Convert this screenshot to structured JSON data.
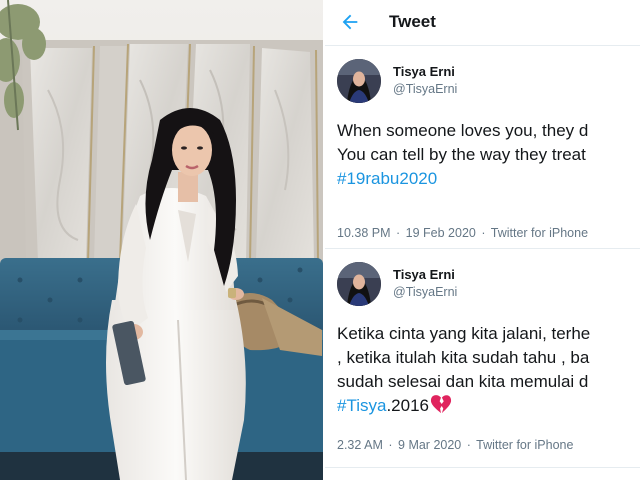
{
  "header": {
    "title": "Tweet",
    "back_icon": "back-arrow-icon"
  },
  "tweets": [
    {
      "display_name": "Tisya Erni",
      "handle": "@TisyaErni",
      "lines": [
        "When someone loves you, they d",
        "You can tell by the way they treat"
      ],
      "hashtag": "#19rabu2020",
      "time": "10.38 PM",
      "date": "19 Feb 2020",
      "source": "Twitter for iPhone"
    },
    {
      "display_name": "Tisya Erni",
      "handle": "@TisyaErni",
      "lines": [
        "Ketika cinta yang kita jalani, terhe",
        ", ketika itulah kita sudah tahu , ba",
        "sudah selesai dan kita memulai d"
      ],
      "hashtag": "#Tisya",
      "hashtag_suffix": ".2016",
      "emoji_icon": "broken-heart-icon",
      "time": "2.32 AM",
      "date": "9 Mar 2020",
      "source": "Twitter for iPhone"
    }
  ],
  "colors": {
    "link": "#1b95e0",
    "text": "#14171a",
    "secondary": "#657786",
    "divider": "#e6ecf0",
    "heart": "#e0245e"
  }
}
